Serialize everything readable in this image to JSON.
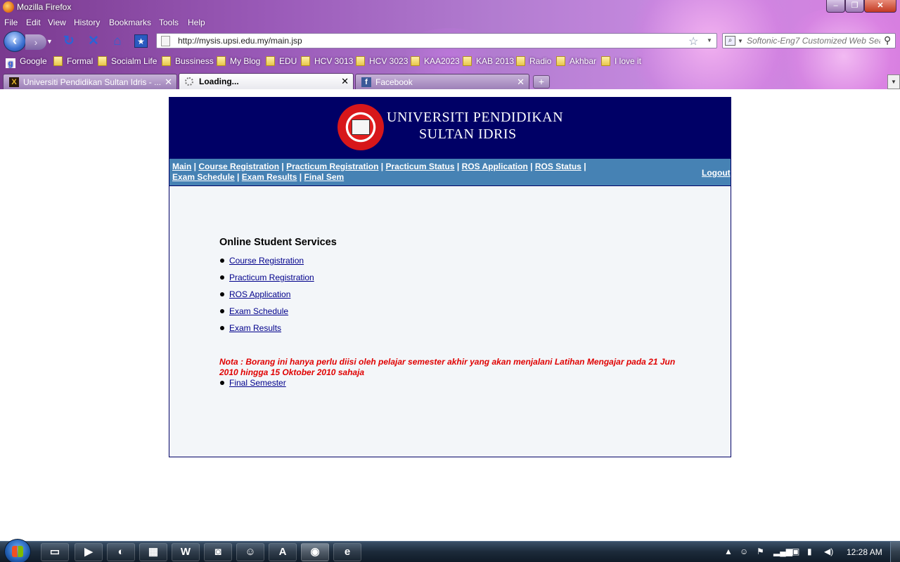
{
  "window": {
    "title": "Mozilla Firefox"
  },
  "menu": [
    "File",
    "Edit",
    "View",
    "History",
    "Bookmarks",
    "Tools",
    "Help"
  ],
  "address_bar": {
    "url": "http://mysis.upsi.edu.my/main.jsp"
  },
  "search_bar": {
    "placeholder": "Softonic-Eng7 Customized Web Sear"
  },
  "bookmarks": [
    "Google",
    "Formal",
    "Socialm Life",
    "Bussiness",
    "My Blog",
    "EDU",
    "HCV 3013",
    "HCV 3023",
    "KAA2023",
    "KAB 2013",
    "Radio",
    "Akhbar",
    "I love it"
  ],
  "tabs": [
    {
      "label": "Universiti Pendidikan Sultan Idris - ...",
      "active": false
    },
    {
      "label": "Loading...",
      "active": true
    },
    {
      "label": "Facebook",
      "active": false
    }
  ],
  "header": {
    "line1": "UNIVERSITI PENDIDIKAN",
    "line2": "SULTAN IDRIS"
  },
  "topnav": {
    "links": [
      "Main",
      "Course Registration",
      "Practicum Registration",
      "Practicum Status",
      "ROS Application",
      "ROS Status",
      "Exam Schedule",
      "Exam Results",
      "Final Sem"
    ],
    "logout": "Logout"
  },
  "main": {
    "title": "Online Student Services",
    "services": [
      "Course Registration",
      "Practicum Registration",
      "ROS Application",
      "Exam Schedule",
      "Exam Results"
    ],
    "note": "Nota : Borang ini hanya perlu diisi oleh pelajar semester akhir yang akan menjalani Latihan Mengajar pada 21 Jun 2010 hingga 15 Oktober 2010 sahaja",
    "final_link": "Final Semester"
  },
  "taskbar": {
    "clock": "12:28 AM"
  },
  "colors": {
    "header_bg": "#000066",
    "nav_bg": "#4682b4",
    "panel_bg": "#f3f6f9",
    "link": "#00008b",
    "note": "#e00000"
  }
}
